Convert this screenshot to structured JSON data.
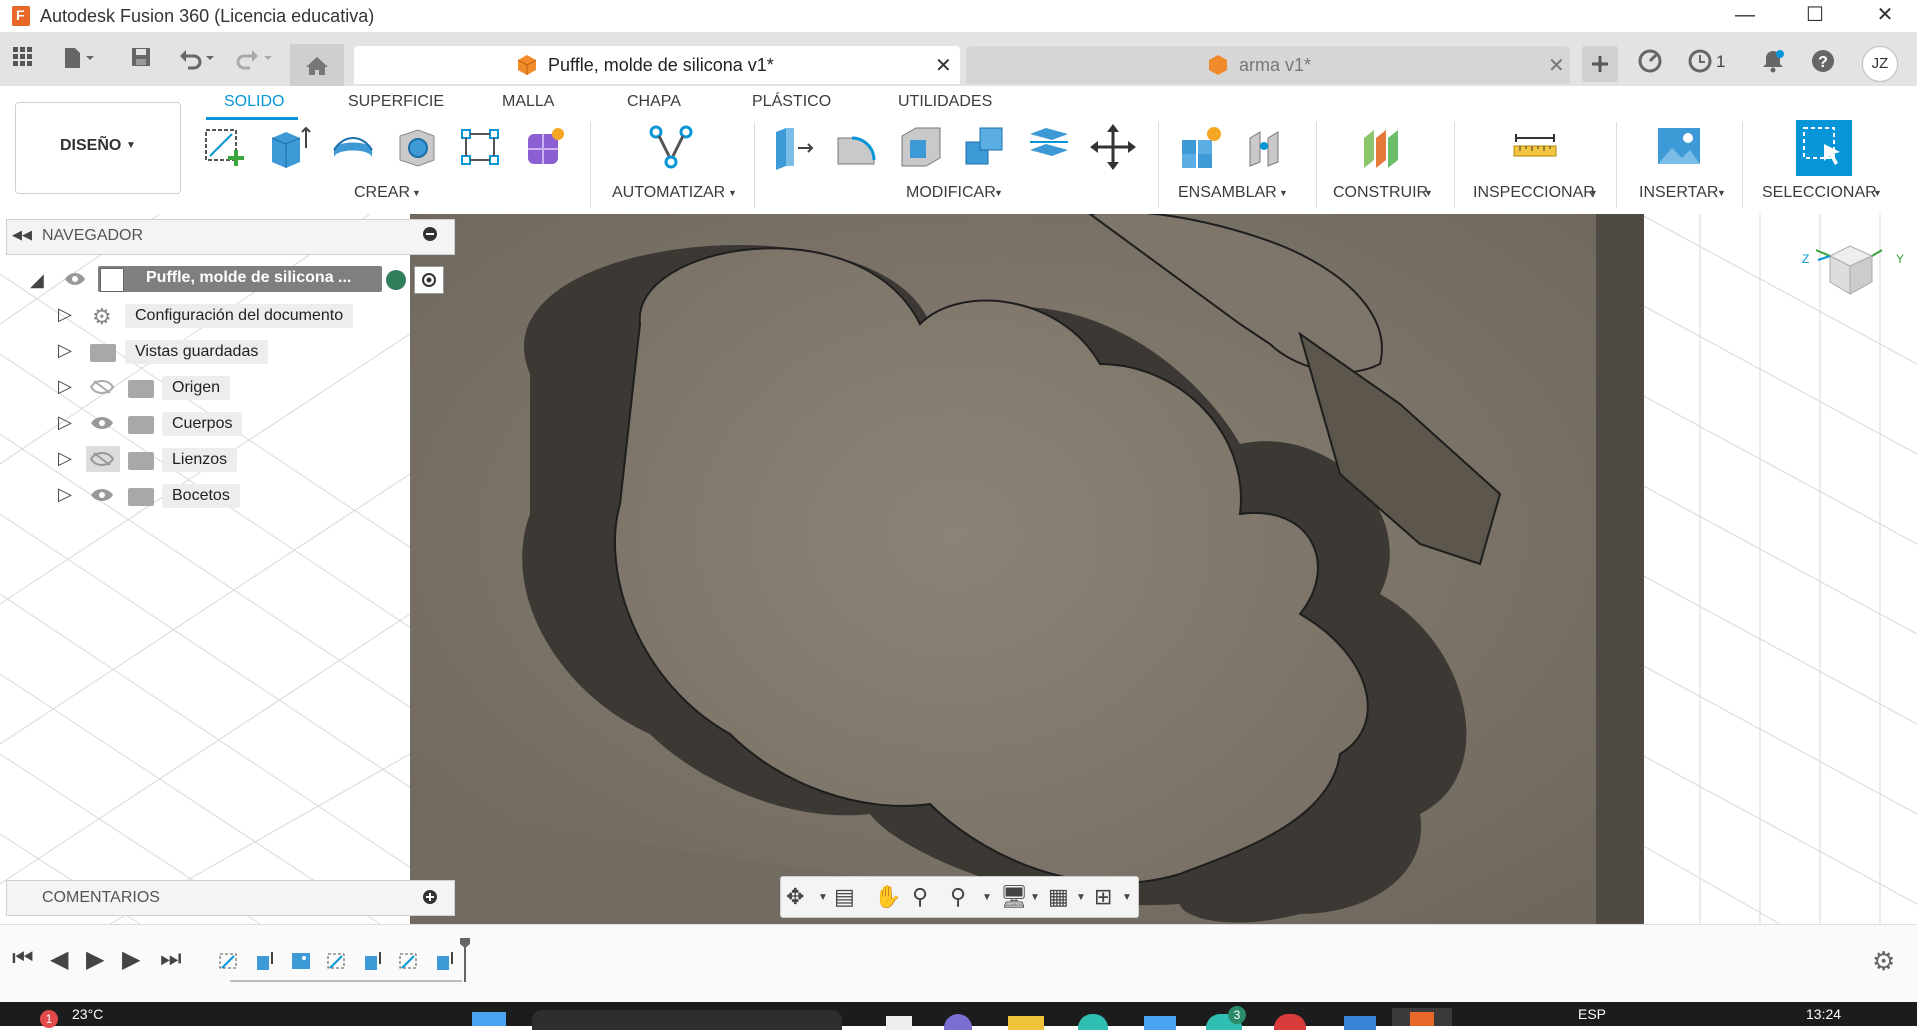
{
  "window": {
    "title": "Autodesk Fusion 360 (Licencia educativa)",
    "controls": {
      "minimize": "—",
      "maximize": "☐",
      "close": "✕"
    }
  },
  "tabbar": {
    "tabs": [
      {
        "title": "Puffle, molde de silicona v1*",
        "active": true
      },
      {
        "title": "arma v1*",
        "active": false
      }
    ],
    "job_count": "1",
    "user_initials": "JZ"
  },
  "ribbon": {
    "workspace": "DISEÑO",
    "tabs": [
      "SOLIDO",
      "SUPERFICIE",
      "MALLA",
      "CHAPA",
      "PLÁSTICO",
      "UTILIDADES"
    ],
    "active_tab": "SOLIDO",
    "groups": {
      "crear": "CREAR",
      "automatizar": "AUTOMATIZAR",
      "modificar": "MODIFICAR",
      "ensamblar": "ENSAMBLAR",
      "construir": "CONSTRUIR",
      "inspeccionar": "INSPECCIONAR",
      "insertar": "INSERTAR",
      "seleccionar": "SELECCIONAR"
    },
    "accent_color": "#0696d7"
  },
  "navigator": {
    "header": "NAVEGADOR",
    "root": "Puffle, molde de silicona ...",
    "items": [
      {
        "label": "Configuración del documento",
        "icon": "gear-icon",
        "eye": "none"
      },
      {
        "label": "Vistas guardadas",
        "icon": "folder-icon",
        "eye": "none"
      },
      {
        "label": "Origen",
        "icon": "folder-icon",
        "eye": "hidden"
      },
      {
        "label": "Cuerpos",
        "icon": "folder-icon",
        "eye": "visible"
      },
      {
        "label": "Lienzos",
        "icon": "folder-icon",
        "eye": "hidden"
      },
      {
        "label": "Bocetos",
        "icon": "folder-icon",
        "eye": "visible"
      }
    ]
  },
  "comments": {
    "header": "COMENTARIOS"
  },
  "viewcube": {
    "z": "Z",
    "y": "Y"
  },
  "taskbar": {
    "temperature": "23°C",
    "weather_badge": "1",
    "app_badge": "3",
    "language": "ESP",
    "time": "13:24"
  }
}
